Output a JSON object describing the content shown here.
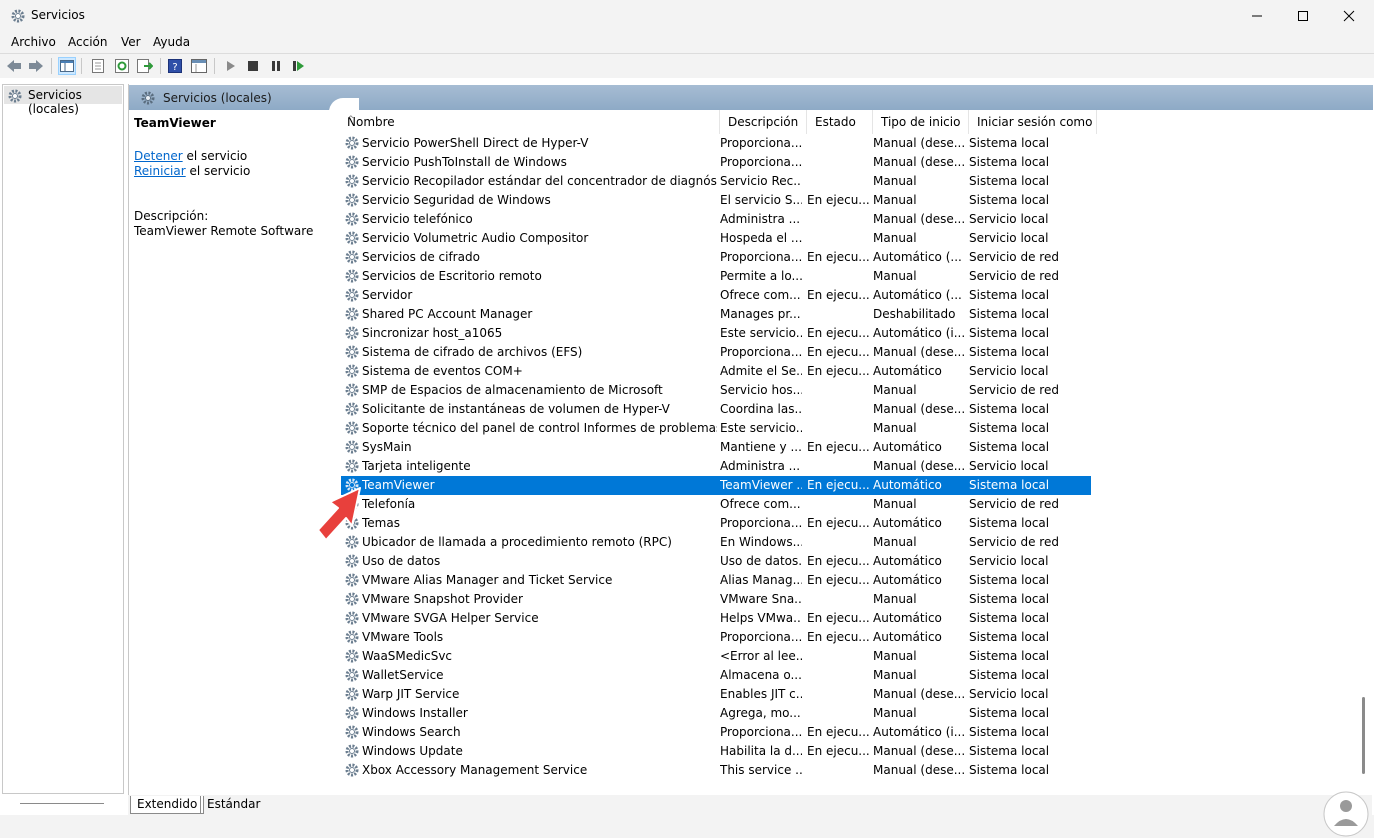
{
  "window": {
    "title": "Servicios",
    "icon": "gear-icon",
    "minimize": "—",
    "maximize": "☐",
    "close": "✕"
  },
  "menu": [
    "Archivo",
    "Acción",
    "Ver",
    "Ayuda"
  ],
  "tree": {
    "root": "Servicios (locales)"
  },
  "panel_header": "Servicios (locales)",
  "details": {
    "title": "TeamViewer",
    "stop_link": "Detener",
    "stop_rest": " el servicio",
    "restart_link": "Reiniciar",
    "restart_rest": " el servicio",
    "desc_label": "Descripción:",
    "desc_text": "TeamViewer Remote Software"
  },
  "columns": [
    "Nombre",
    "Descripción",
    "Estado",
    "Tipo de inicio",
    "Iniciar sesión como"
  ],
  "rows": [
    [
      "Servicio PowerShell Direct de Hyper-V",
      "Proporciona...",
      "",
      "Manual (dese...",
      "Sistema local"
    ],
    [
      "Servicio PushToInstall de Windows",
      "Proporciona...",
      "",
      "Manual (dese...",
      "Sistema local"
    ],
    [
      "Servicio Recopilador estándar del concentrador de diagnósticos ...",
      "Servicio Rec...",
      "",
      "Manual",
      "Sistema local"
    ],
    [
      "Servicio Seguridad de Windows",
      "El servicio S...",
      "En ejecu...",
      "Manual",
      "Sistema local"
    ],
    [
      "Servicio telefónico",
      "Administra ...",
      "",
      "Manual (dese...",
      "Servicio local"
    ],
    [
      "Servicio Volumetric Audio Compositor",
      "Hospeda el ...",
      "",
      "Manual",
      "Servicio local"
    ],
    [
      "Servicios de cifrado",
      "Proporciona...",
      "En ejecu...",
      "Automático (...",
      "Servicio de red"
    ],
    [
      "Servicios de Escritorio remoto",
      "Permite a lo...",
      "",
      "Manual",
      "Servicio de red"
    ],
    [
      "Servidor",
      "Ofrece com...",
      "En ejecu...",
      "Automático (...",
      "Sistema local"
    ],
    [
      "Shared PC Account Manager",
      "Manages pr...",
      "",
      "Deshabilitado",
      "Sistema local"
    ],
    [
      "Sincronizar host_a1065",
      "Este servicio...",
      "En ejecu...",
      "Automático (i...",
      "Sistema local"
    ],
    [
      "Sistema de cifrado de archivos (EFS)",
      "Proporciona...",
      "En ejecu...",
      "Manual (dese...",
      "Sistema local"
    ],
    [
      "Sistema de eventos COM+",
      "Admite el Se...",
      "En ejecu...",
      "Automático",
      "Servicio local"
    ],
    [
      "SMP de Espacios de almacenamiento de Microsoft",
      "Servicio hos...",
      "",
      "Manual",
      "Servicio de red"
    ],
    [
      "Solicitante de instantáneas de volumen de Hyper-V",
      "Coordina las...",
      "",
      "Manual (dese...",
      "Sistema local"
    ],
    [
      "Soporte técnico del panel de control Informes de problemas",
      "Este servicio...",
      "",
      "Manual",
      "Sistema local"
    ],
    [
      "SysMain",
      "Mantiene y ...",
      "En ejecu...",
      "Automático",
      "Sistema local"
    ],
    [
      "Tarjeta inteligente",
      "Administra ...",
      "",
      "Manual (dese...",
      "Servicio local"
    ],
    [
      "TeamViewer",
      "TeamViewer ...",
      "En ejecu...",
      "Automático",
      "Sistema local"
    ],
    [
      "Telefonía",
      "Ofrece com...",
      "",
      "Manual",
      "Servicio de red"
    ],
    [
      "Temas",
      "Proporciona...",
      "En ejecu...",
      "Automático",
      "Sistema local"
    ],
    [
      "Ubicador de llamada a procedimiento remoto (RPC)",
      "En Windows...",
      "",
      "Manual",
      "Servicio de red"
    ],
    [
      "Uso de datos",
      "Uso de datos...",
      "En ejecu...",
      "Automático",
      "Servicio local"
    ],
    [
      "VMware Alias Manager and Ticket Service",
      "Alias Manag...",
      "En ejecu...",
      "Automático",
      "Sistema local"
    ],
    [
      "VMware Snapshot Provider",
      "VMware Sna...",
      "",
      "Manual",
      "Sistema local"
    ],
    [
      "VMware SVGA Helper Service",
      "Helps VMwa...",
      "En ejecu...",
      "Automático",
      "Sistema local"
    ],
    [
      "VMware Tools",
      "Proporciona...",
      "En ejecu...",
      "Automático",
      "Sistema local"
    ],
    [
      "WaaSMedicSvc",
      "<Error al lee...",
      "",
      "Manual",
      "Sistema local"
    ],
    [
      "WalletService",
      "Almacena o...",
      "",
      "Manual",
      "Sistema local"
    ],
    [
      "Warp JIT Service",
      "Enables JIT c...",
      "",
      "Manual (dese...",
      "Servicio local"
    ],
    [
      "Windows Installer",
      "Agrega, mo...",
      "",
      "Manual",
      "Sistema local"
    ],
    [
      "Windows Search",
      "Proporciona...",
      "En ejecu...",
      "Automático (i...",
      "Sistema local"
    ],
    [
      "Windows Update",
      "Habilita la d...",
      "En ejecu...",
      "Manual (dese...",
      "Sistema local"
    ],
    [
      "Xbox Accessory Management Service",
      "This service ...",
      "",
      "Manual (dese...",
      "Sistema local"
    ]
  ],
  "selected_row": "TeamViewer",
  "tabs": [
    "Extendido",
    "Estándar"
  ],
  "colors": {
    "selection": "#0078d7",
    "header_band": "#9bb3cc",
    "link": "#0066cc",
    "arrow": "#e8403c"
  }
}
